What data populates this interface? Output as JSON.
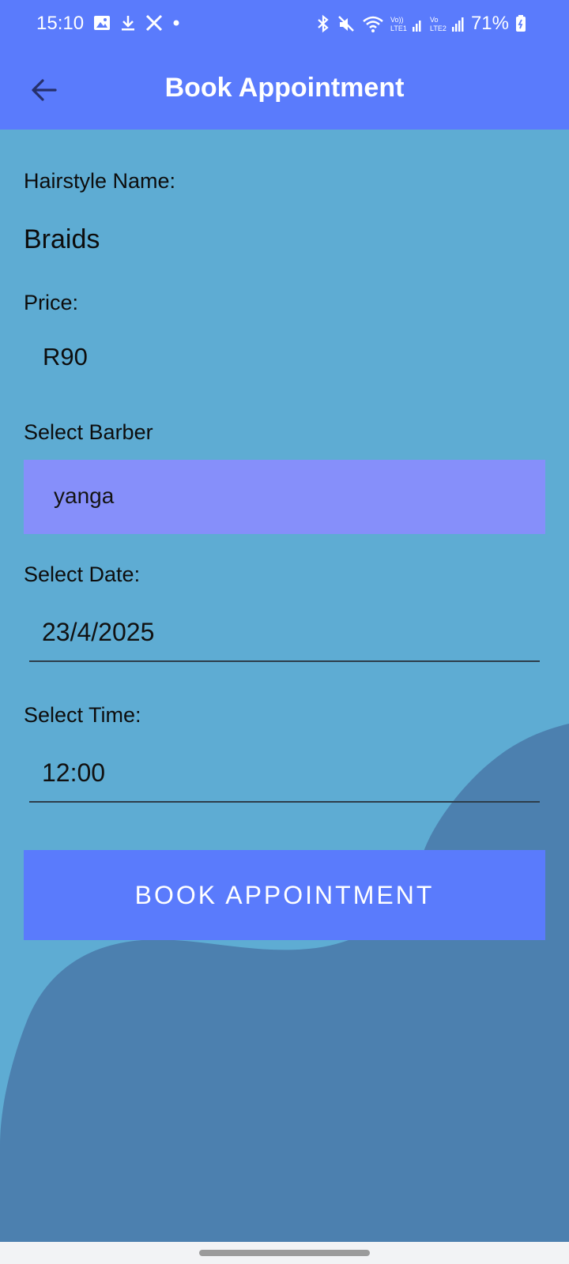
{
  "status_bar": {
    "time": "15:10",
    "battery": "71%",
    "left_icons": [
      "gallery-icon",
      "download-icon",
      "x-icon",
      "dot-icon"
    ],
    "right_icons": [
      "bluetooth-icon",
      "mute-icon",
      "wifi-icon",
      "lte1-signal-icon",
      "lte2-signal-icon",
      "battery-icon"
    ]
  },
  "app_bar": {
    "title": "Book Appointment",
    "back_icon": "arrow-left-icon"
  },
  "form": {
    "hairstyle_label": "Hairstyle Name:",
    "hairstyle_value": "Braids",
    "price_label": "Price:",
    "price_value": "R90",
    "barber_label": "Select Barber",
    "barber_value": "yanga",
    "date_label": "Select Date:",
    "date_value": "23/4/2025",
    "time_label": "Select Time:",
    "time_value": "12:00",
    "book_button": "BOOK APPOINTMENT"
  },
  "colors": {
    "primary": "#5A7BFC",
    "background": "#5EACD3",
    "wave": "#4C80AF",
    "spinner": "#868FFA"
  }
}
